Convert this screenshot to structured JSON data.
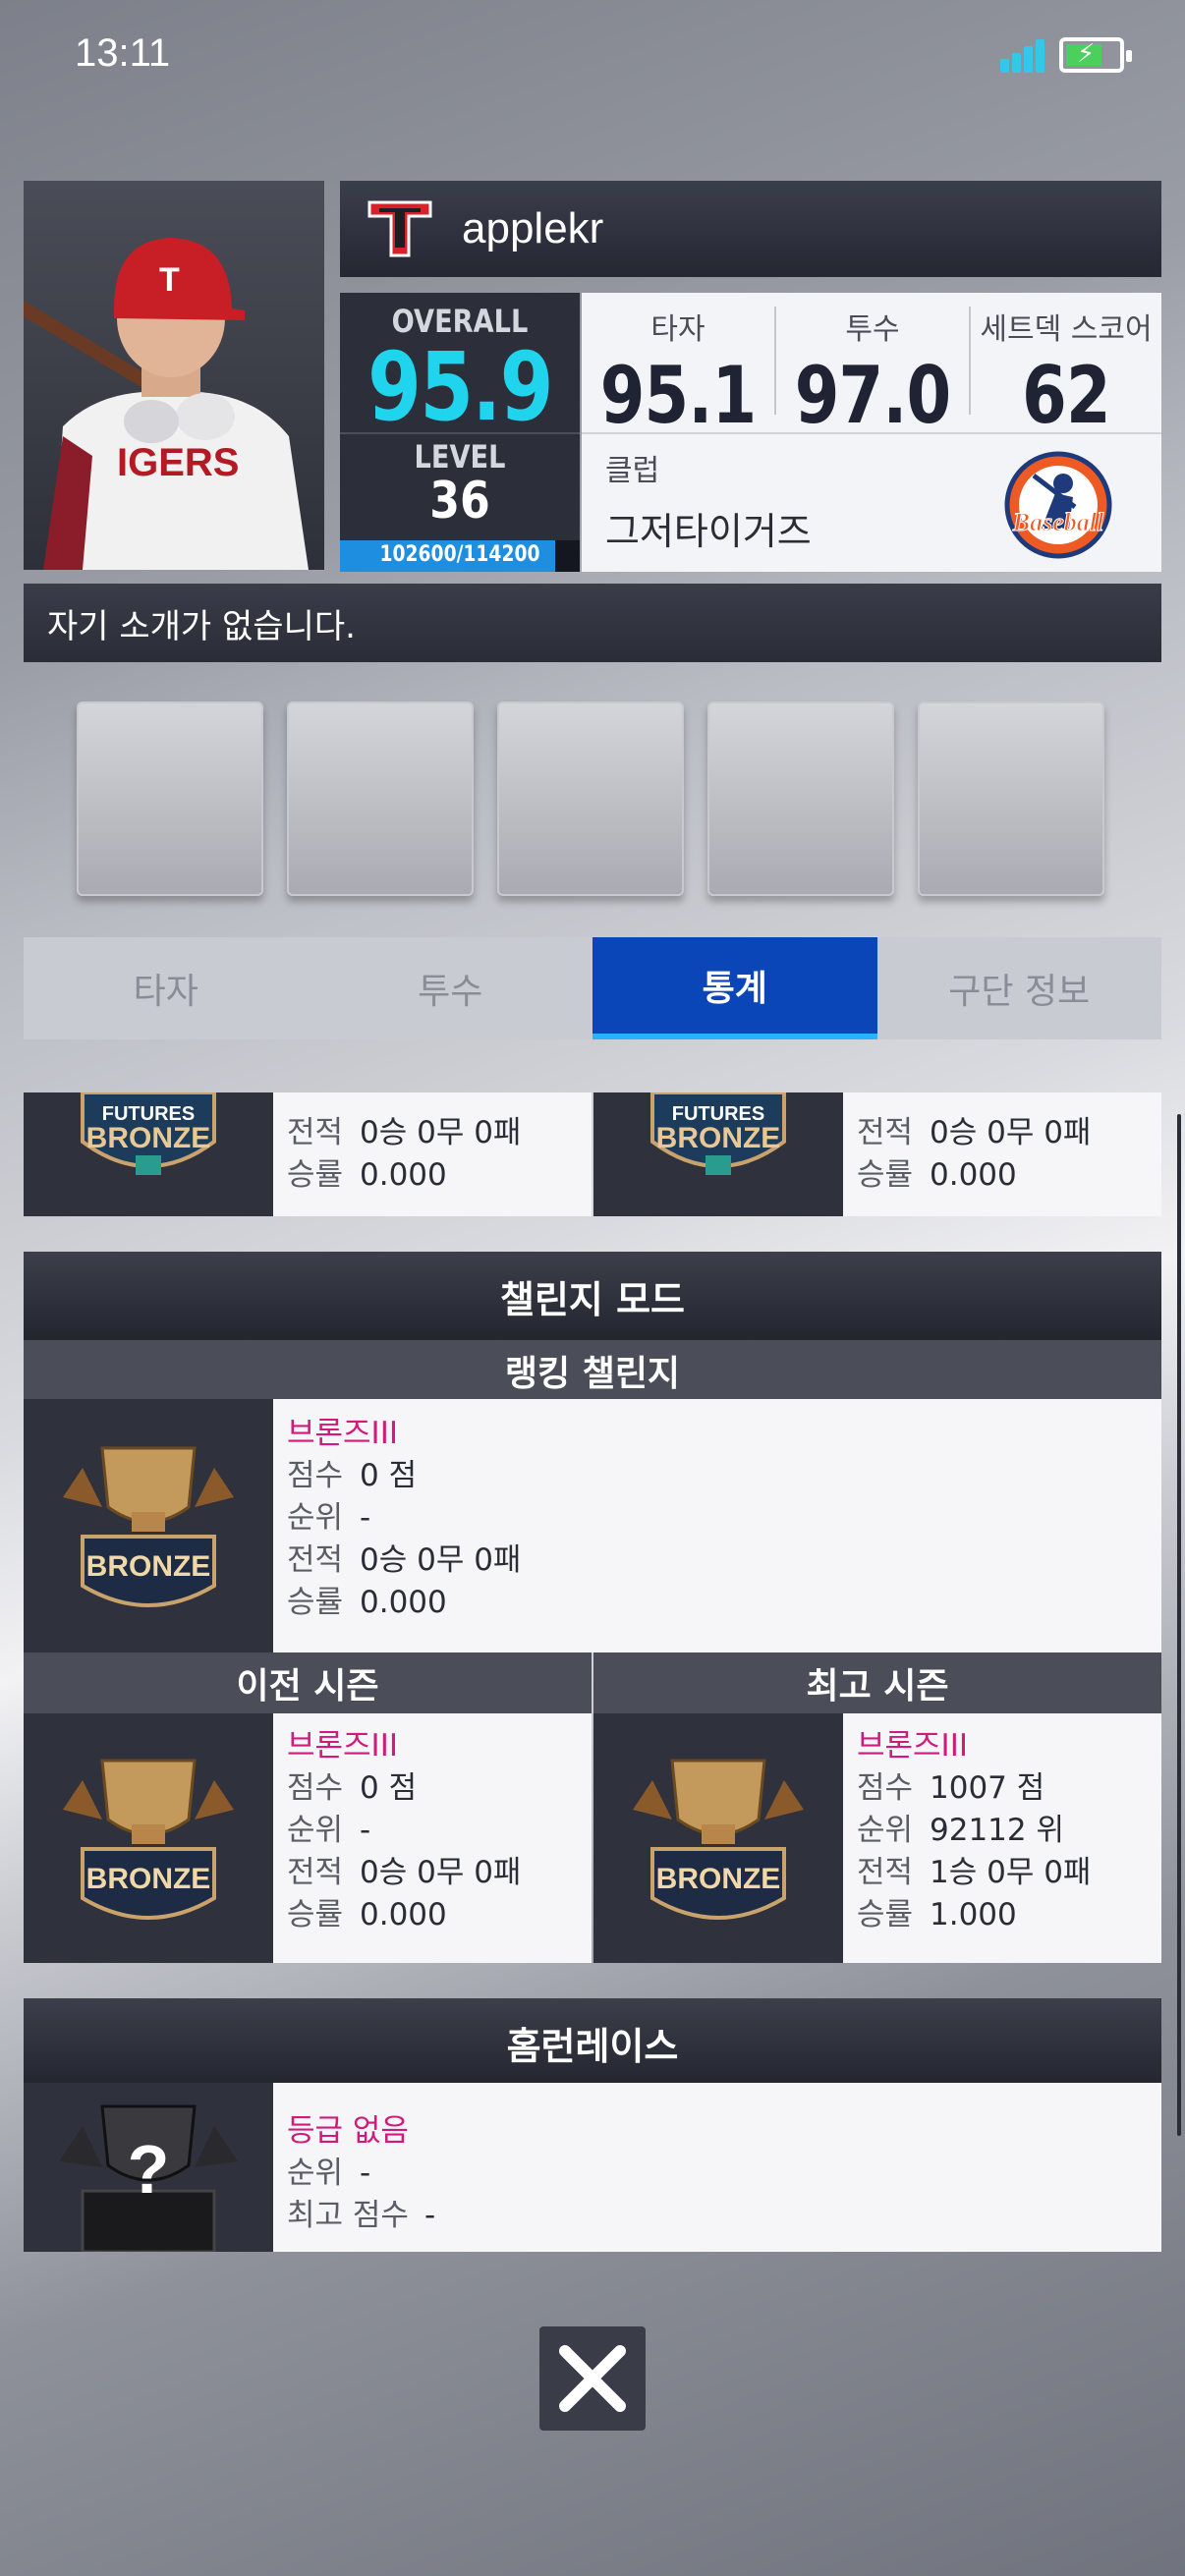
{
  "status_bar": {
    "time": "13:11"
  },
  "profile": {
    "username": "applekr",
    "overall_label": "OVERALL",
    "overall_value": "95.9",
    "level_label": "LEVEL",
    "level_value": "36",
    "xp_text": "102600/114200",
    "xp_fraction": 0.898,
    "stats": [
      {
        "label": "타자",
        "value": "95.1"
      },
      {
        "label": "투수",
        "value": "97.0"
      },
      {
        "label": "세트덱 스코어",
        "value": "62"
      }
    ],
    "club_label": "클럽",
    "club_name": "그저타이거즈",
    "club_logo_text": "Baseball",
    "intro": "자기 소개가 없습니다."
  },
  "tabs": [
    {
      "label": "타자",
      "active": false
    },
    {
      "label": "투수",
      "active": false
    },
    {
      "label": "통계",
      "active": true
    },
    {
      "label": "구단 정보",
      "active": false
    }
  ],
  "futures": {
    "left": {
      "badge_line1": "FUTURES",
      "badge_line2": "BRONZE",
      "record_key": "전적",
      "record": "0승 0무 0패",
      "rate_key": "승률",
      "rate": "0.000"
    },
    "right": {
      "badge_line1": "FUTURES",
      "badge_line2": "BRONZE",
      "record_key": "전적",
      "record": "0승 0무 0패",
      "rate_key": "승률",
      "rate": "0.000"
    }
  },
  "challenge": {
    "title": "챌린지 모드",
    "ranking_title": "랭킹 챌린지",
    "current": {
      "tier": "브론즈III",
      "score_key": "점수",
      "score": "0 점",
      "rank_key": "순위",
      "rank": "-",
      "record_key": "전적",
      "record": "0승 0무 0패",
      "rate_key": "승률",
      "rate": "0.000",
      "badge": "BRONZE"
    },
    "prev_title": "이전 시즌",
    "best_title": "최고 시즌",
    "prev": {
      "tier": "브론즈III",
      "score_key": "점수",
      "score": "0 점",
      "rank_key": "순위",
      "rank": "-",
      "record_key": "전적",
      "record": "0승 0무 0패",
      "rate_key": "승률",
      "rate": "0.000",
      "badge": "BRONZE"
    },
    "best": {
      "tier": "브론즈III",
      "score_key": "점수",
      "score": "1007 점",
      "rank_key": "순위",
      "rank": "92112 위",
      "record_key": "전적",
      "record": "1승 0무 0패",
      "rate_key": "승률",
      "rate": "1.000",
      "badge": "BRONZE"
    }
  },
  "homerun": {
    "title": "홈런레이스",
    "tier": "등급 없음",
    "rank_key": "순위",
    "rank": "-",
    "best_key": "최고 점수",
    "best": "-"
  },
  "colors": {
    "accent": "#0b46b8",
    "overall": "#21d4ee",
    "tier": "#d01a7c"
  }
}
